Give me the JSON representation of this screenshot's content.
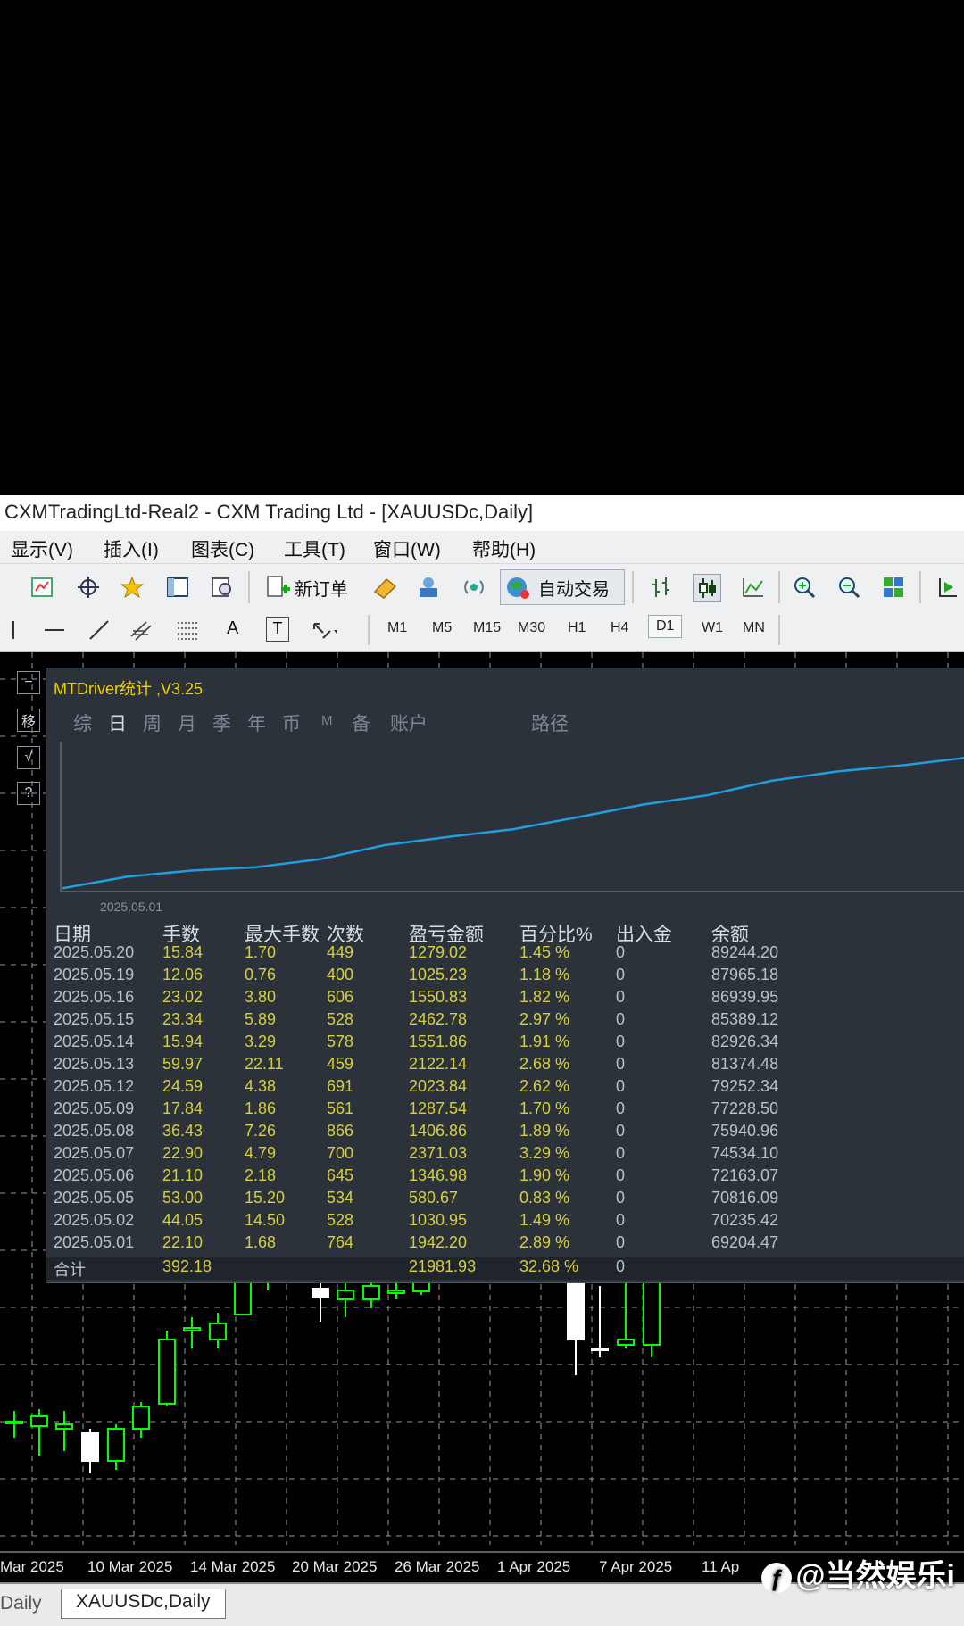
{
  "window": {
    "title": "CXMTradingLtd-Real2 - CXM Trading Ltd - [XAUUSDc,Daily]"
  },
  "menu": [
    "显示(V)",
    "插入(I)",
    "图表(C)",
    "工具(T)",
    "窗口(W)",
    "帮助(H)"
  ],
  "toolbar": {
    "new_order_label": "新订单",
    "auto_trade_label": "自动交易",
    "draw_text_label": "A",
    "draw_textlabel_label": "T",
    "timeframes": [
      "M1",
      "M5",
      "M15",
      "M30",
      "H1",
      "H4",
      "D1",
      "W1",
      "MN"
    ],
    "active_timeframe": "D1"
  },
  "panel": {
    "title": "MTDriver统计 ,V3.25",
    "tabs": [
      "综",
      "日",
      "周",
      "月",
      "季",
      "年",
      "币",
      "M",
      "备",
      "账户",
      "路径"
    ],
    "active_tab": "日",
    "side_buttons": [
      "−",
      "移",
      "√",
      "?"
    ],
    "equity_start_label": "2025.05.01",
    "equity_line_color": "#1f9fe0",
    "columns": [
      "日期",
      "手数",
      "最大手数",
      "次数",
      "盈亏金额",
      "百分比%",
      "出入金",
      "余额"
    ],
    "rows": [
      [
        "2025.05.20",
        "15.84",
        "1.70",
        "449",
        "1279.02",
        "1.45 %",
        "0",
        "89244.20"
      ],
      [
        "2025.05.19",
        "12.06",
        "0.76",
        "400",
        "1025.23",
        "1.18 %",
        "0",
        "87965.18"
      ],
      [
        "2025.05.16",
        "23.02",
        "3.80",
        "606",
        "1550.83",
        "1.82 %",
        "0",
        "86939.95"
      ],
      [
        "2025.05.15",
        "23.34",
        "5.89",
        "528",
        "2462.78",
        "2.97 %",
        "0",
        "85389.12"
      ],
      [
        "2025.05.14",
        "15.94",
        "3.29",
        "578",
        "1551.86",
        "1.91 %",
        "0",
        "82926.34"
      ],
      [
        "2025.05.13",
        "59.97",
        "22.11",
        "459",
        "2122.14",
        "2.68 %",
        "0",
        "81374.48"
      ],
      [
        "2025.05.12",
        "24.59",
        "4.38",
        "691",
        "2023.84",
        "2.62 %",
        "0",
        "79252.34"
      ],
      [
        "2025.05.09",
        "17.84",
        "1.86",
        "561",
        "1287.54",
        "1.70 %",
        "0",
        "77228.50"
      ],
      [
        "2025.05.08",
        "36.43",
        "7.26",
        "866",
        "1406.86",
        "1.89 %",
        "0",
        "75940.96"
      ],
      [
        "2025.05.07",
        "22.90",
        "4.79",
        "700",
        "2371.03",
        "3.29 %",
        "0",
        "74534.10"
      ],
      [
        "2025.05.06",
        "21.10",
        "2.18",
        "645",
        "1346.98",
        "1.90 %",
        "0",
        "72163.07"
      ],
      [
        "2025.05.05",
        "53.00",
        "15.20",
        "534",
        "580.67",
        "0.83 %",
        "0",
        "70816.09"
      ],
      [
        "2025.05.02",
        "44.05",
        "14.50",
        "528",
        "1030.95",
        "1.49 %",
        "0",
        "70235.42"
      ],
      [
        "2025.05.01",
        "22.10",
        "1.68",
        "764",
        "1942.20",
        "2.89 %",
        "0",
        "69204.47"
      ]
    ],
    "total": {
      "label": "合计",
      "lots": "392.18",
      "profit": "21981.93",
      "percent": "32.68 %",
      "deposit": "0"
    }
  },
  "chart": {
    "x_axis_labels": [
      "Mar 2025",
      "10 Mar 2025",
      "14 Mar 2025",
      "20 Mar 2025",
      "26 Mar 2025",
      "1 Apr 2025",
      "7 Apr 2025",
      "11 Ap"
    ],
    "bull_color": "#00ff00",
    "bear_color": "#ffffff"
  },
  "bottom_tabs": [
    "Daily",
    "XAUUSDc,Daily"
  ],
  "watermark": "@当然娱乐i"
}
